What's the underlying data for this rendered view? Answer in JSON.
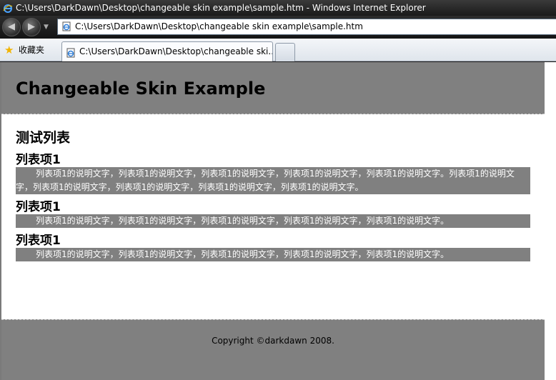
{
  "window": {
    "title": "C:\\Users\\DarkDawn\\Desktop\\changeable skin example\\sample.htm - Windows Internet Explorer"
  },
  "navbar": {
    "address": "C:\\Users\\DarkDawn\\Desktop\\changeable skin example\\sample.htm"
  },
  "tabs": {
    "favorites_label": "收藏夹",
    "active_tab_title": "C:\\Users\\DarkDawn\\Desktop\\changeable ski..."
  },
  "page": {
    "header_title": "Changeable Skin Example",
    "section_title": "测试列表",
    "items": [
      {
        "title": "列表项1",
        "description": "列表项1的说明文字，列表项1的说明文字，列表项1的说明文字，列表项1的说明文字，列表项1的说明文字。列表项1的说明文字，列表项1的说明文字，列表项1的说明文字，列表项1的说明文字，列表项1的说明文字。"
      },
      {
        "title": "列表项1",
        "description": "列表项1的说明文字，列表项1的说明文字，列表项1的说明文字，列表项1的说明文字，列表项1的说明文字。"
      },
      {
        "title": "列表项1",
        "description": "列表项1的说明文字，列表项1的说明文字，列表项1的说明文字，列表项1的说明文字，列表项1的说明文字。"
      }
    ],
    "footer_text": "Copyright ©darkdawn 2008."
  },
  "icons": {
    "ie": "ie-logo-icon",
    "back": "back-arrow-icon",
    "forward": "forward-arrow-icon",
    "favorites": "star-icon",
    "page": "page-icon"
  },
  "colors": {
    "header_bg": "#808080",
    "footer_bg": "#808080",
    "item_description_bg": "#808080",
    "item_description_text": "#ffffff"
  }
}
